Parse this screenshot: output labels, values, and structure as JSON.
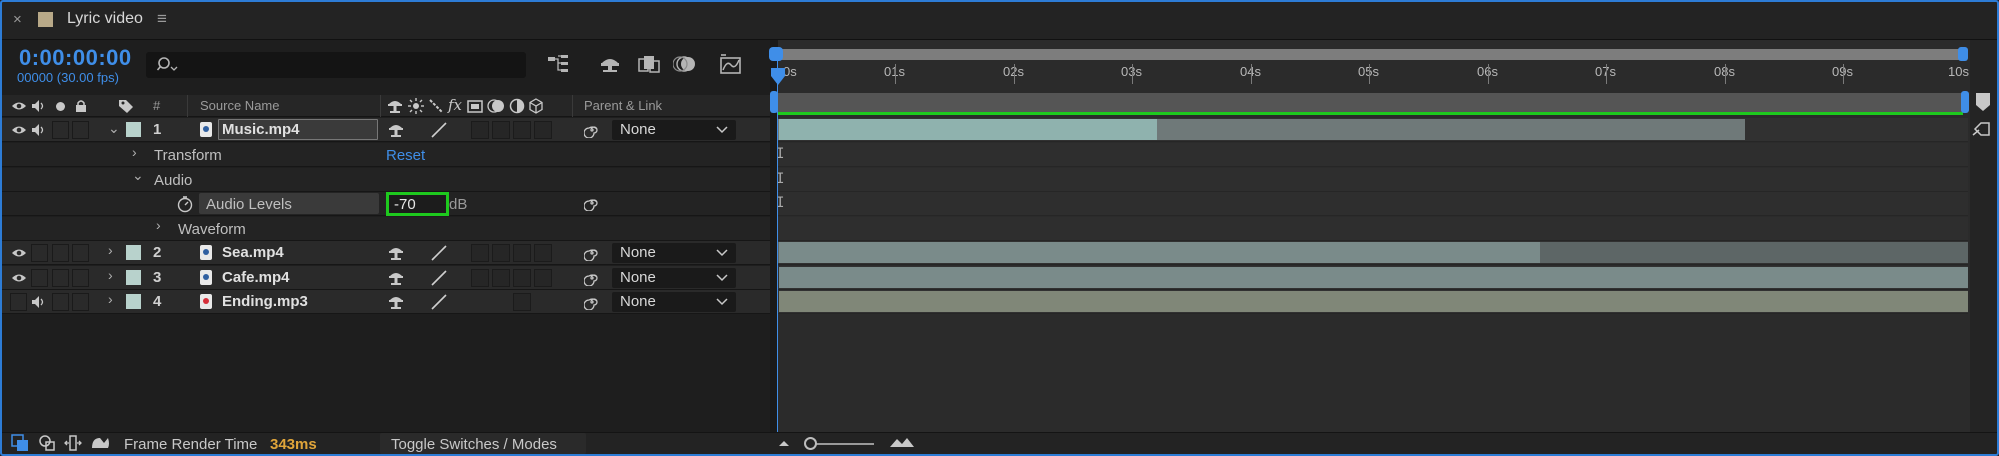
{
  "panel": {
    "close_glyph": "×",
    "title": "Lyric video",
    "menu_glyph": "≡",
    "swatch_color": "#b8a988"
  },
  "controls": {
    "timecode": "0:00:00:00",
    "frames": "00000 (30.00 fps)",
    "search_placeholder": ""
  },
  "columns": {
    "num": "#",
    "source_name": "Source Name",
    "parent_link": "Parent & Link"
  },
  "layers": [
    {
      "num": "1",
      "name": "Music.mp4",
      "parent": "None",
      "file_type": "video",
      "expanded": true
    },
    {
      "num": "2",
      "name": "Sea.mp4",
      "parent": "None",
      "file_type": "video",
      "expanded": false
    },
    {
      "num": "3",
      "name": "Cafe.mp4",
      "parent": "None",
      "file_type": "video",
      "expanded": false
    },
    {
      "num": "4",
      "name": "Ending.mp3",
      "parent": "None",
      "file_type": "audio",
      "expanded": false
    }
  ],
  "properties": {
    "transform": "Transform",
    "transform_reset": "Reset",
    "audio": "Audio",
    "audio_levels": "Audio Levels",
    "audio_levels_value": "-70",
    "audio_levels_unit": "dB",
    "waveform": "Waveform"
  },
  "ruler": {
    "labels": [
      "0s",
      "01s",
      "02s",
      "03s",
      "04s",
      "05s",
      "06s",
      "07s",
      "08s",
      "09s",
      "10s"
    ]
  },
  "footer": {
    "frame_render_label": "Frame Render Time",
    "frame_render_value": "343ms",
    "toggle_label": "Toggle Switches / Modes"
  },
  "colors": {
    "accent": "#3f8ee8",
    "highlight_box": "#1ec91e",
    "render_time": "#e0a53a",
    "layer_label": "#b8d2cc"
  }
}
